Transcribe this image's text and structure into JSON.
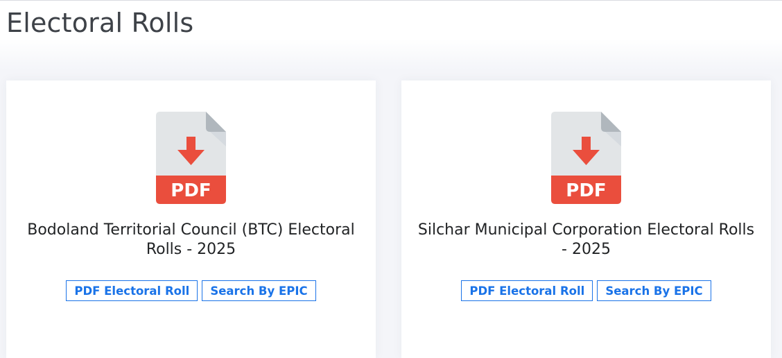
{
  "page": {
    "title": "Electoral Rolls"
  },
  "cards": [
    {
      "icon": "pdf-download-icon",
      "icon_label": "PDF",
      "title": "Bodoland Territorial Council (BTC) Electoral Rolls - 2025",
      "buttons": {
        "pdf": "PDF Electoral Roll",
        "epic": "Search By EPIC"
      }
    },
    {
      "icon": "pdf-download-icon",
      "icon_label": "PDF",
      "title": "Silchar Municipal Corporation Electoral Rolls - 2025",
      "buttons": {
        "pdf": "PDF Electoral Roll",
        "epic": "Search By EPIC"
      }
    }
  ],
  "colors": {
    "accent": "#1a73e8",
    "pdf_red": "#ea4e3d",
    "doc_gray": "#e2e5e7",
    "fold_gray": "#b0b7bd",
    "title_text": "#3e4248"
  }
}
